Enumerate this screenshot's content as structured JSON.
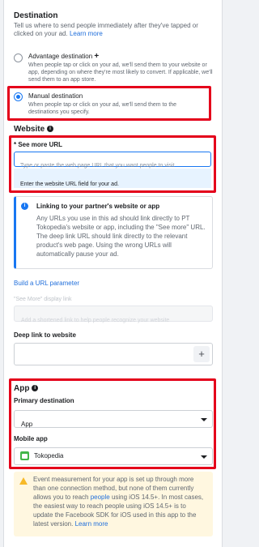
{
  "destination": {
    "title": "Destination",
    "desc": "Tell us where to send people immediately after they've tapped or clicked on your ad.",
    "learn_more": "Learn more",
    "advantage": {
      "label": "Advantage destination",
      "plus": "+",
      "desc": "When people tap or click on your ad, we'll send them to your website or app, depending on where they're most likely to convert. If applicable, we'll send them to an app store."
    },
    "manual": {
      "label": "Manual destination",
      "desc": "When people tap or click on your ad, we'll send them to the destinations you specify."
    }
  },
  "website": {
    "title": "Website",
    "see_more_label": "* See more URL",
    "url_placeholder": "Type or paste the web page URL that you want people to visit",
    "url_error": "Enter the website URL field for your ad.",
    "partner": {
      "title": "Linking to your partner's website or app",
      "body": "Any URLs you use in this ad should link directly to PT Tokopedia's website or app, including the \"See more\" URL. The deep link URL should link directly to the relevant product's web page. Using the wrong URLs will automatically pause your ad."
    },
    "build_url": "Build a URL parameter",
    "display_link_label": "\"See More\" display link",
    "display_link_placeholder": "Add a shortened link to help people recognize your website",
    "deep_link_label": "Deep link to website",
    "plus": "+"
  },
  "app": {
    "title": "App",
    "primary_label": "Primary destination",
    "primary_value": "App",
    "mobile_label": "Mobile app",
    "mobile_value": "Tokopedia",
    "warning": "Event measurement for your app is set up through more than one connection method, but none of them currently allows you to reach people using iOS 14.5+. In most cases, the easiest way to reach people using iOS 14.5+ is to update the Facebook SDK for iOS used in this app to the latest version.",
    "warning_link_people": "people",
    "learn_more": "Learn more"
  },
  "colors": {
    "accent": "#1877f2",
    "highlight": "#e4001b",
    "warning_bg": "#fff7e0"
  },
  "icons": [
    "info-icon",
    "plus-icon",
    "chevron-down-icon",
    "tokopedia-app-icon",
    "warning-icon"
  ]
}
